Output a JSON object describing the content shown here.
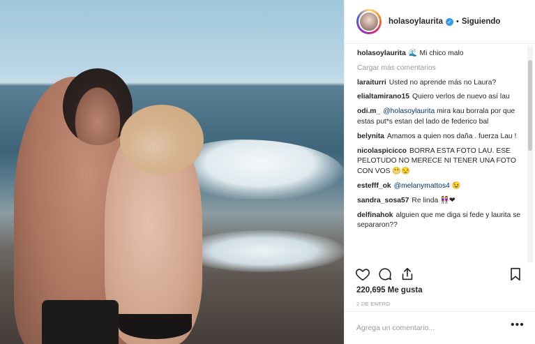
{
  "header": {
    "username": "holasoylaurita",
    "separator": "•",
    "follow_status": "Siguiendo",
    "verified_glyph": "✓"
  },
  "caption": {
    "username": "holasoylaurita",
    "emoji": "🌊",
    "text": "Mi chico malo"
  },
  "load_more": "Cargar más comentarios",
  "comments": [
    {
      "user": "laraiturri",
      "text": "Usted no aprende más no Laura?"
    },
    {
      "user": "elialtamirano15",
      "text": "Quiero verlos de nuevo así lau"
    },
    {
      "user": "odi.m_",
      "mention": "@holasoylaurita",
      "text": "mira kau borrala por que estas put*s estan del lado de federico bal"
    },
    {
      "user": "belynita",
      "text": "Amamos a quien nos daña . fuerza Lau !"
    },
    {
      "user": "nicolaspicicco",
      "text": "BORRA ESTA FOTO LAU. ESE PELOTUDO NO MERECE NI TENER UNA FOTO CON VOS 😬😒"
    },
    {
      "user": "estefff_ok",
      "mention": "@melanymattos4",
      "text": "😉"
    },
    {
      "user": "sandra_sosa57",
      "text": "Re linda 👭❤"
    },
    {
      "user": "delfinahok",
      "text": "alguien que me diga si fede y laurita se separaron??"
    }
  ],
  "likes_text": "220,695 Me gusta",
  "date_text": "2 DE ENERO",
  "add_comment": {
    "placeholder": "Agrega un comentario..."
  },
  "more_glyph": "•••",
  "icons": [
    "heart-icon",
    "comment-icon",
    "share-icon",
    "bookmark-icon",
    "verified-icon",
    "more-options-icon"
  ],
  "colors": {
    "verified": "#3897f0",
    "mention": "#003569",
    "muted": "#999999"
  }
}
